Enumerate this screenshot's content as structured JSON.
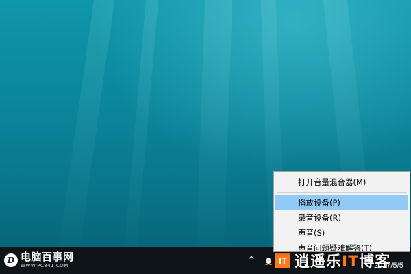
{
  "context_menu": {
    "items": [
      {
        "label": "打开音量混合器(M)",
        "highlighted": false
      },
      {
        "label": "播放设备(P)",
        "highlighted": true
      },
      {
        "label": "录音设备(R)",
        "highlighted": false
      },
      {
        "label": "声音(S)",
        "highlighted": false
      },
      {
        "label": "声音问题疑难解答(T)",
        "highlighted": false
      }
    ]
  },
  "taskbar": {
    "chevron_icon": "^",
    "tray_icons": [
      "chevron-up-icon",
      "qq-penguin-icon"
    ],
    "clock_date": "2017/5/5"
  },
  "watermarks": {
    "left": {
      "logo_letter": "D",
      "title": "电脑百事网",
      "url": "WWW.PC841.COM"
    },
    "right": {
      "logo_text": "IT",
      "prefix": "逍遥乐",
      "highlight": "IT",
      "suffix": "博客"
    }
  },
  "colors": {
    "desktop_background": "#0b8398",
    "taskbar": "#0f1418",
    "menu_background": "#f2f2f2",
    "menu_highlight": "#91c9f7",
    "brand_orange": "#ff7a1a"
  }
}
